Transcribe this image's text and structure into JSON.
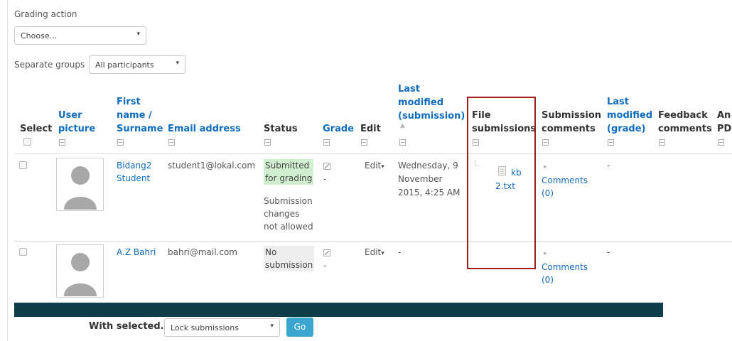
{
  "grading_action": {
    "label": "Grading action",
    "select_value": "Choose..."
  },
  "groups": {
    "label": "Separate groups",
    "select_value": "All participants"
  },
  "columns": {
    "select": "Select",
    "user_picture": [
      "User",
      "picture"
    ],
    "first_name": [
      "First",
      "name /"
    ],
    "surname": "Surname",
    "email": "Email address",
    "status": "Status",
    "grade": "Grade",
    "edit": "Edit",
    "last_modified_submission": [
      "Last",
      "modified",
      "(submission)"
    ],
    "file_submissions": [
      "File",
      "submissions"
    ],
    "submission_comments": [
      "Submission",
      "comments"
    ],
    "last_modified_grade": [
      "Last",
      "modified",
      "(grade)"
    ],
    "feedback_comments": [
      "Feedback",
      "comments"
    ],
    "annotate_pdf": [
      "An",
      "PD"
    ]
  },
  "rows": [
    {
      "name": [
        "Bidang2",
        "Student"
      ],
      "email": "student1@lokal.com",
      "status_lines": [
        "Submitted",
        "for grading"
      ],
      "status_note": [
        "Submission",
        "changes",
        "not allowed"
      ],
      "grade": "-",
      "edit": "Edit",
      "last_modified": [
        "Wednesday, 9",
        "November",
        "2015, 4:25 AM"
      ],
      "file_name": [
        "kb",
        "2.txt"
      ],
      "comments": [
        "Comments",
        "(0)"
      ],
      "last_modified_grade": "-"
    },
    {
      "name": [
        "A.Z Bahri"
      ],
      "email": "bahri@mail.com",
      "status_lines": [
        "No",
        "submission"
      ],
      "grade": "-",
      "edit": "Edit",
      "last_modified": [
        "-"
      ],
      "comments": [
        "Comments",
        "(0)"
      ],
      "last_modified_grade": "-"
    }
  ],
  "footer": {
    "with_selected_label": "With selected...",
    "action_value": "Lock submissions",
    "go_label": "Go"
  },
  "icons": {
    "dropdown_caret": "▾",
    "sort_arrow": "▲",
    "expand_arrow": "▸",
    "edit_caret": "▾"
  },
  "colors": {
    "link": "#0f6cbf",
    "submitted_bg": "#cfefcf",
    "highlight_box": "#a11a1a",
    "footer_bar": "#0e3d4a",
    "go_button": "#3aa6cf"
  }
}
